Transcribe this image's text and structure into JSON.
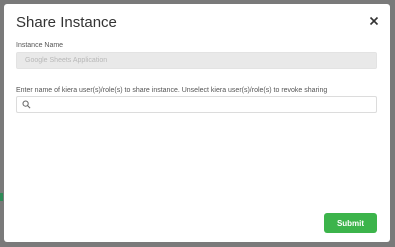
{
  "modal": {
    "title": "Share Instance",
    "close_icon": "close-icon",
    "instance_name_label": "Instance Name",
    "instance_name_value": "Google Sheets Application",
    "share_label": "Enter name of kiera user(s)/role(s) to share instance. Unselect kiera user(s)/role(s) to revoke sharing",
    "search_icon": "search-icon",
    "search_value": "",
    "search_placeholder": "",
    "submit_label": "Submit"
  },
  "colors": {
    "accent": "#3cb44b",
    "backdrop": "#7a7a7a"
  }
}
